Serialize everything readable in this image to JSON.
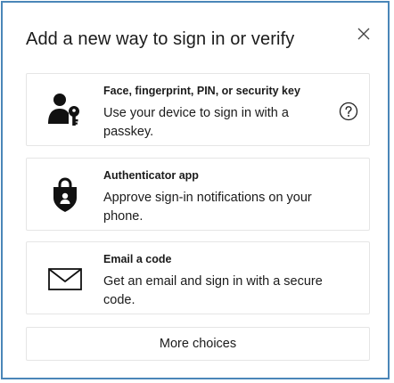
{
  "dialog": {
    "title": "Add a new way to sign in or verify",
    "close_icon": "close-icon"
  },
  "options": [
    {
      "icon": "user-key-icon",
      "heading": "Face, fingerprint, PIN, or security key",
      "description": "Use your device to sign in with a passkey.",
      "help_icon": "question-circle-icon"
    },
    {
      "icon": "shield-lock-icon",
      "heading": "Authenticator app",
      "description": "Approve sign-in notifications on your phone."
    },
    {
      "icon": "envelope-icon",
      "heading": "Email a code",
      "description": "Get an email and sign in with a secure code."
    }
  ],
  "more_choices_label": "More choices",
  "colors": {
    "dialog_border": "#4a86b8",
    "card_border": "#e5e5e5",
    "text": "#1b1b1b"
  }
}
